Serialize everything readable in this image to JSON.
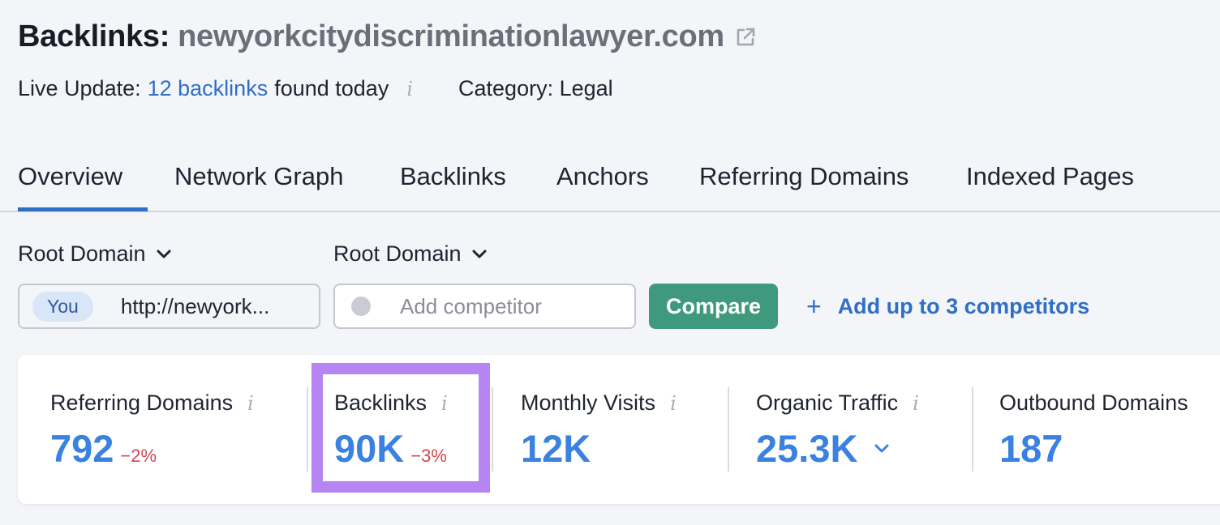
{
  "header": {
    "title_label": "Backlinks:",
    "domain": "newyorkcitydiscriminationlawyer.com",
    "external_link_icon": "external-link-icon"
  },
  "meta": {
    "live_update_prefix": "Live Update:",
    "live_update_link": "12 backlinks",
    "live_update_suffix": "found today",
    "info_glyph": "i",
    "category": "Category: Legal"
  },
  "tabs": [
    {
      "label": "Overview",
      "active": true
    },
    {
      "label": "Network Graph"
    },
    {
      "label": "Backlinks"
    },
    {
      "label": "Anchors"
    },
    {
      "label": "Referring Domains"
    },
    {
      "label": "Indexed Pages"
    }
  ],
  "filters": {
    "root_domain_1": "Root Domain",
    "root_domain_2": "Root Domain",
    "you_badge": "You",
    "you_url": "http://newyork...",
    "competitor_placeholder": "Add competitor",
    "compare_button": "Compare",
    "add_competitors_plus": "+",
    "add_competitors": "Add up to 3 competitors"
  },
  "metrics": [
    {
      "label": "Referring Domains",
      "value": "792",
      "change": "−2%"
    },
    {
      "label": "Backlinks",
      "value": "90K",
      "change": "−3%",
      "highlighted": true
    },
    {
      "label": "Monthly Visits",
      "value": "12K"
    },
    {
      "label": "Organic Traffic",
      "value": "25.3K"
    },
    {
      "label": "Outbound Domains",
      "value": "187"
    }
  ],
  "colors": {
    "accent_blue": "#2f6fc6",
    "metric_blue": "#3b82e0",
    "negative_red": "#d1454f",
    "compare_green": "#3f9a7d",
    "highlight_purple": "#b785f3"
  }
}
